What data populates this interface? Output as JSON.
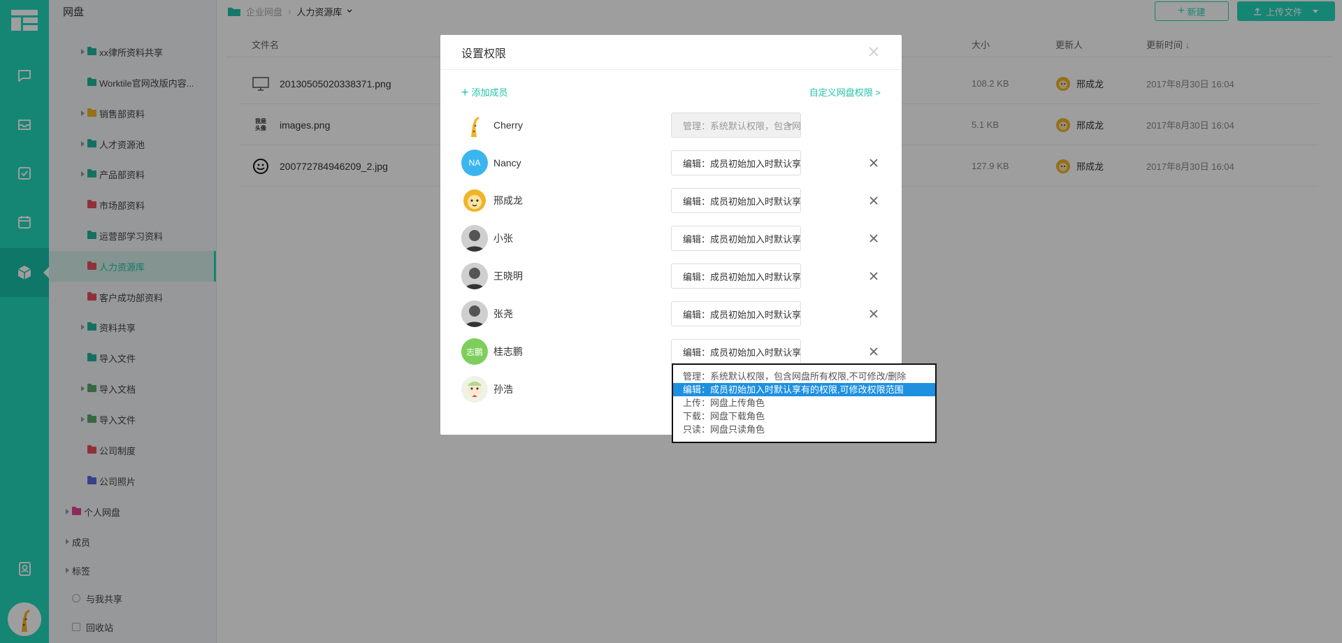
{
  "sidebar": {
    "title": "网盘",
    "items": [
      {
        "label": "xx律所资料共享",
        "color": "#22b59d",
        "indent": 1,
        "arrow": true
      },
      {
        "label": "Worktile官网改版内容...",
        "color": "#22b59d",
        "indent": 1,
        "arrow": false
      },
      {
        "label": "销售部资料",
        "color": "#f0b429",
        "indent": 1,
        "arrow": true
      },
      {
        "label": "人才资源池",
        "color": "#22b59d",
        "indent": 1,
        "arrow": true
      },
      {
        "label": "产品部资料",
        "color": "#22b59d",
        "indent": 1,
        "arrow": true
      },
      {
        "label": "市场部资料",
        "color": "#e8505b",
        "indent": 1,
        "arrow": false
      },
      {
        "label": "运营部学习资料",
        "color": "#22b59d",
        "indent": 1,
        "arrow": false
      },
      {
        "label": "人力资源库",
        "color": "#e8505b",
        "indent": 1,
        "arrow": false,
        "active": true
      },
      {
        "label": "客户成功部资料",
        "color": "#e8505b",
        "indent": 1,
        "arrow": false
      },
      {
        "label": "资料共享",
        "color": "#22b59d",
        "indent": 1,
        "arrow": true
      },
      {
        "label": "导入文件",
        "color": "#22b59d",
        "indent": 1,
        "arrow": false
      },
      {
        "label": "导入文档",
        "color": "#5aa86a",
        "indent": 1,
        "arrow": true
      },
      {
        "label": "导入文件",
        "color": "#5aa86a",
        "indent": 1,
        "arrow": true
      },
      {
        "label": "公司制度",
        "color": "#e8505b",
        "indent": 1,
        "arrow": false
      },
      {
        "label": "公司照片",
        "color": "#5a6ad8",
        "indent": 1,
        "arrow": false
      },
      {
        "label": "个人网盘",
        "color": "#e84393",
        "indent": 0,
        "arrow": true
      },
      {
        "label": "成员",
        "color": "",
        "indent": -1,
        "arrow": true
      },
      {
        "label": "标签",
        "color": "",
        "indent": -1,
        "arrow": true
      },
      {
        "label": "与我共享",
        "color": "",
        "indent": -1,
        "arrow": false
      },
      {
        "label": "回收站",
        "color": "",
        "indent": -1,
        "arrow": false
      }
    ]
  },
  "header": {
    "breadcrumb_root": "企业网盘",
    "breadcrumb_sep": "›",
    "breadcrumb_current": "人力资源库",
    "new_button": "新建",
    "upload_button": "上传文件"
  },
  "table": {
    "col_name": "文件名",
    "col_size": "大小",
    "col_updater": "更新人",
    "col_updated": "更新时间",
    "rows": [
      {
        "name": "20130505020338371.png",
        "size": "108.2 KB",
        "updater": "邢成龙",
        "updated": "2017年8月30日 16:04",
        "thumb": "monitor"
      },
      {
        "name": "images.png",
        "size": "5.1 KB",
        "updater": "邢成龙",
        "updated": "2017年8月30日 16:04",
        "thumb": "text"
      },
      {
        "name": "200772784946209_2.jpg",
        "size": "127.9 KB",
        "updater": "邢成龙",
        "updated": "2017年8月30日 16:04",
        "thumb": "smile"
      }
    ],
    "thumb_text": "我是 头像"
  },
  "modal": {
    "title": "设置权限",
    "add_member": "添加成员",
    "custom_link": "自定义网盘权限 >",
    "members": [
      {
        "name": "Cherry",
        "role": "管理：系统默认权限，包含网盘所有权限",
        "avatar": "giraffe",
        "removable": false,
        "disabled": true
      },
      {
        "name": "Nancy",
        "role": "编辑：成员初始加入时默认享有的权限",
        "avatar": "NA",
        "avatar_color": "#3ab5f0",
        "removable": true
      },
      {
        "name": "邢成龙",
        "role": "编辑：成员初始加入时默认享有的权限",
        "avatar": "lion",
        "removable": true
      },
      {
        "name": "小张",
        "role": "编辑：成员初始加入时默认享有的权限",
        "avatar": "photo1",
        "removable": true
      },
      {
        "name": "王晓明",
        "role": "编辑：成员初始加入时默认享有的权限",
        "avatar": "photo2",
        "removable": true
      },
      {
        "name": "张尧",
        "role": "编辑：成员初始加入时默认享有的权限",
        "avatar": "photo3",
        "removable": true
      },
      {
        "name": "桂志鹏",
        "role": "编辑：成员初始加入时默认享有的权限",
        "avatar": "志鹏",
        "avatar_color": "#7dce5a",
        "removable": true
      },
      {
        "name": "孙浩",
        "role": "",
        "avatar": "cartoon",
        "removable": false
      }
    ]
  },
  "dropdown": {
    "options": [
      {
        "label": "管理：系统默认权限，包含网盘所有权限,不可修改/删除",
        "selected": false
      },
      {
        "label": "编辑：成员初始加入时默认享有的权限,可修改权限范围",
        "selected": true
      },
      {
        "label": "上传：网盘上传角色",
        "selected": false
      },
      {
        "label": "下载：网盘下载角色",
        "selected": false
      },
      {
        "label": "只读：网盘只读角色",
        "selected": false
      }
    ]
  },
  "colors": {
    "accent": "#22d7bb",
    "accent_dark": "#22c3a8",
    "select_highlight": "#1e90e0"
  }
}
